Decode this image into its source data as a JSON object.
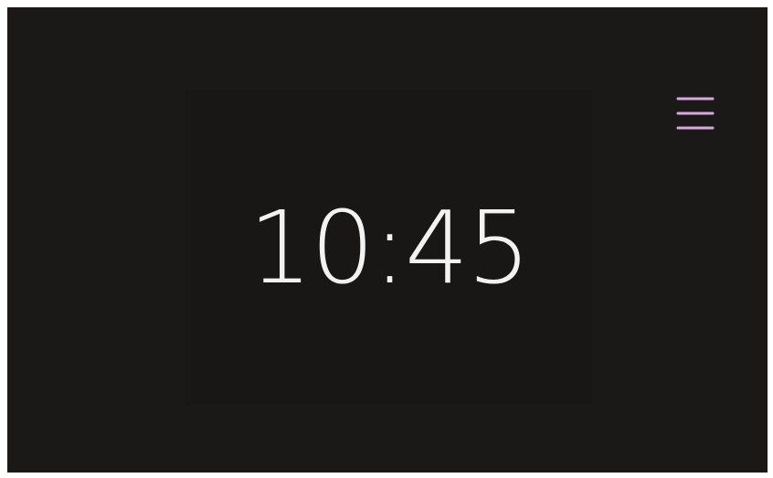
{
  "clock": {
    "time": "10:45"
  },
  "menu": {
    "icon": "hamburger-menu-icon",
    "color": "#d8a8e0"
  },
  "colors": {
    "background": "#1b1918",
    "panel": "#181716",
    "text": "#f2f2f2"
  }
}
